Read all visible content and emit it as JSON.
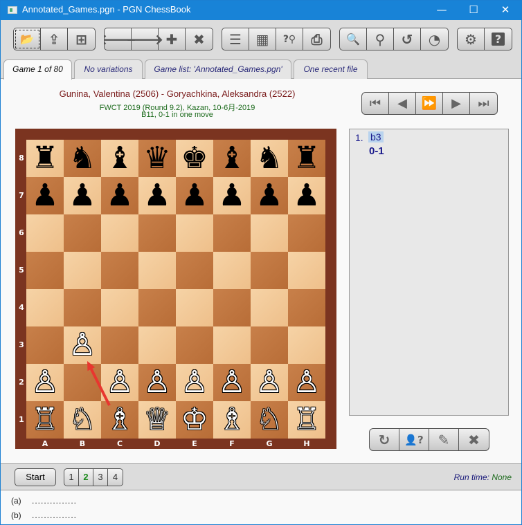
{
  "window": {
    "title": "Annotated_Games.pgn - PGN ChessBook",
    "controls": {
      "minimize": "—",
      "maximize": "☐",
      "close": "✕"
    }
  },
  "toolbar": {
    "groups": [
      [
        {
          "name": "open-file",
          "glyph": "📂"
        },
        {
          "name": "save-file",
          "glyph": "⇪"
        },
        {
          "name": "new-file",
          "glyph": "⊞"
        }
      ],
      [
        {
          "name": "back",
          "glyph": "🡐"
        },
        {
          "name": "forward",
          "glyph": "🡒"
        },
        {
          "name": "add",
          "glyph": "✚"
        },
        {
          "name": "delete",
          "glyph": "✖"
        }
      ],
      [
        {
          "name": "player-list",
          "glyph": "☰"
        },
        {
          "name": "board",
          "glyph": "▦"
        },
        {
          "name": "search-unknown",
          "glyph": "?⚲"
        },
        {
          "name": "print",
          "glyph": "⎙"
        }
      ],
      [
        {
          "name": "search-annotation",
          "glyph": "🔍"
        },
        {
          "name": "search-position",
          "glyph": "⚲"
        },
        {
          "name": "search-back",
          "glyph": "↺"
        },
        {
          "name": "statistics",
          "glyph": "◔"
        }
      ],
      [
        {
          "name": "settings",
          "glyph": "⚙"
        },
        {
          "name": "help-book",
          "glyph": "?"
        }
      ]
    ]
  },
  "tabs": [
    {
      "label": "Game 1 of 80",
      "active": true
    },
    {
      "label": "No variations",
      "active": false
    },
    {
      "label": "Game list:  'Annotated_Games.pgn'",
      "active": false
    },
    {
      "label": "One recent file",
      "active": false
    }
  ],
  "game": {
    "players": "Gunina, Valentina (2506) - Goryachkina, Aleksandra (2522)",
    "event": "FWCT 2019 (Round 9.2),  Kazan,  10-6月-2019",
    "eco_result": "B11,  0-1  in one move"
  },
  "nav_buttons": [
    {
      "name": "first-move",
      "glyph": "⏮"
    },
    {
      "name": "previous-move",
      "glyph": "◀"
    },
    {
      "name": "auto-play",
      "glyph": "⏩"
    },
    {
      "name": "next-move",
      "glyph": "▶"
    },
    {
      "name": "last-move",
      "glyph": "⏭"
    }
  ],
  "board": {
    "ranks": [
      "8",
      "7",
      "6",
      "5",
      "4",
      "3",
      "2",
      "1"
    ],
    "files": [
      "A",
      "B",
      "C",
      "D",
      "E",
      "F",
      "G",
      "H"
    ],
    "position": [
      [
        "♜",
        "♞",
        "♝",
        "♛",
        "♚",
        "♝",
        "♞",
        "♜"
      ],
      [
        "♟",
        "♟",
        "♟",
        "♟",
        "♟",
        "♟",
        "♟",
        "♟"
      ],
      [
        "",
        "",
        "",
        "",
        "",
        "",
        "",
        ""
      ],
      [
        "",
        "",
        "",
        "",
        "",
        "",
        "",
        ""
      ],
      [
        "",
        "",
        "",
        "",
        "",
        "",
        "",
        ""
      ],
      [
        "",
        "♙",
        "",
        "",
        "",
        "",
        "",
        ""
      ],
      [
        "♙",
        "",
        "♙",
        "♙",
        "♙",
        "♙",
        "♙",
        "♙"
      ],
      [
        "♖",
        "♘",
        "♗",
        "♕",
        "♔",
        "♗",
        "♘",
        "♖"
      ]
    ],
    "arrow": {
      "from": "c1",
      "to": "b2",
      "color": "#e8362f"
    }
  },
  "moves": {
    "number": "1.",
    "move": "b3",
    "result": "0-1"
  },
  "action_buttons": [
    {
      "name": "flip-board",
      "glyph": "↻"
    },
    {
      "name": "guess-player",
      "glyph": "👤?"
    },
    {
      "name": "edit",
      "glyph": "✎"
    },
    {
      "name": "close",
      "glyph": "✖"
    }
  ],
  "bottom": {
    "start_label": "Start",
    "pages": [
      {
        "label": "1",
        "current": false
      },
      {
        "label": "2",
        "current": true
      },
      {
        "label": "3",
        "current": false
      },
      {
        "label": "4",
        "current": false
      }
    ],
    "runtime_label": "Run time:",
    "runtime_value": "None"
  },
  "notes": [
    {
      "label": "(a)",
      "value": "...............  "
    },
    {
      "label": "(b)",
      "value": "...............  "
    }
  ]
}
